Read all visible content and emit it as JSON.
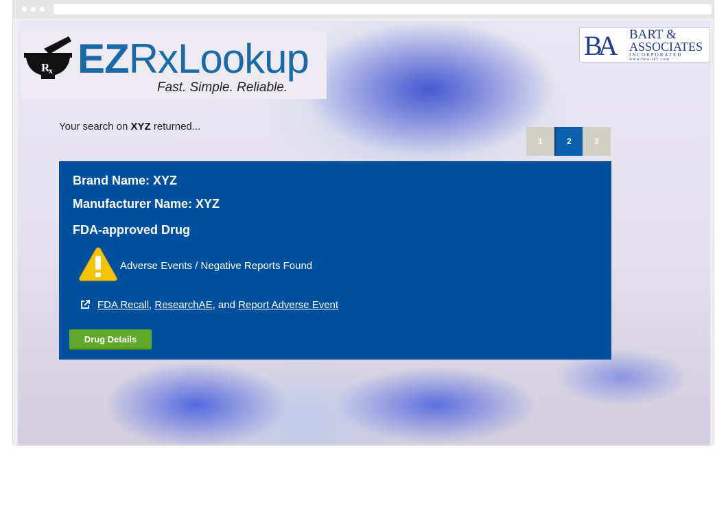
{
  "logo": {
    "ez": "EZ",
    "rx": "Rx",
    "lookup": "Lookup",
    "tagline": "Fast. Simple. Reliable."
  },
  "partner_logo": {
    "mono": "BA",
    "line1": "BART &",
    "line2": "ASSOCIATES",
    "line3": "INCORPORATED",
    "line4": "www.bna-inc.com"
  },
  "search": {
    "prefix": "Your search on",
    "term": "XYZ",
    "suffix": "returned..."
  },
  "pagination": {
    "pages": [
      "1",
      "2",
      "3"
    ],
    "current": "2"
  },
  "result": {
    "brand_label": "Brand Name: XYZ",
    "manufacturer_label": "Manufacturer Name: XYZ",
    "approval": "FDA-approved Drug",
    "adverse_text": "Adverse Events / Negative Reports Found",
    "link_fda_recall": "FDA Recall",
    "link_sep1": ",",
    "link_research": "ResearchAE",
    "link_sep2": ", and",
    "link_report": "Report Adverse Event",
    "details_button": "Drug Details"
  },
  "colors": {
    "panel": "#01509e",
    "accent_button": "#5fa829",
    "logo_blue": "#1a6aa5",
    "page_active": "#0a5fae",
    "page_inactive": "#d2d0c6",
    "warning": "#f5c400"
  },
  "icons": {
    "logo": "mortar-pestle-icon",
    "warning": "warning-triangle-icon",
    "external": "external-link-icon"
  }
}
